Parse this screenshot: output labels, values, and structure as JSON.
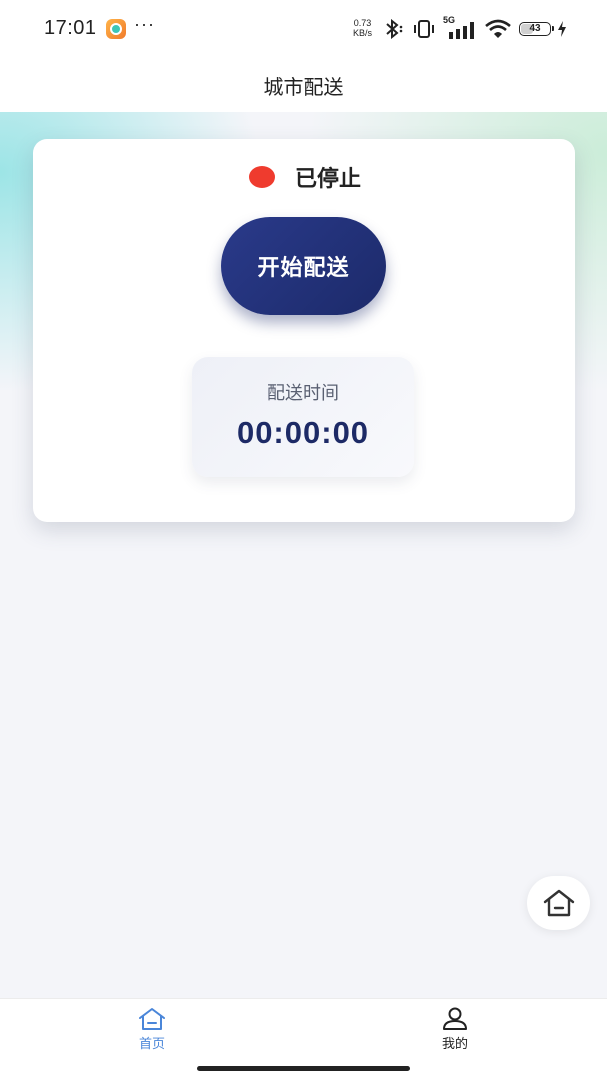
{
  "status_bar": {
    "time": "17:01",
    "more": "···",
    "speed_value": "0.73",
    "speed_unit": "KB/s",
    "network": "5G",
    "battery": "43",
    "battery_level": 0.43
  },
  "nav": {
    "title": "城市配送"
  },
  "card": {
    "status_text": "已停止",
    "status_color": "#ef3b2e",
    "start_button": "开始配送",
    "time_label": "配送时间",
    "time_value": "00:00:00"
  },
  "tabs": [
    {
      "label": "首页",
      "icon": "home-icon",
      "active": true
    },
    {
      "label": "我的",
      "icon": "user-icon",
      "active": false
    }
  ],
  "colors": {
    "accent": "#4a86d9",
    "button": "#1f2e72",
    "timer": "#1d2a66"
  }
}
